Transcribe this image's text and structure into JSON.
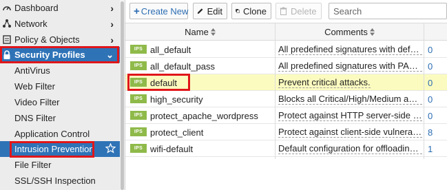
{
  "sidebar": {
    "top_items": [
      {
        "label": "Dashboard",
        "icon": "dashboard-icon"
      },
      {
        "label": "Network",
        "icon": "network-icon"
      },
      {
        "label": "Policy & Objects",
        "icon": "policy-icon"
      }
    ],
    "active_parent": {
      "label": "Security Profiles",
      "icon": "lock-icon"
    },
    "sub_items": [
      {
        "label": "AntiVirus"
      },
      {
        "label": "Web Filter"
      },
      {
        "label": "Video Filter"
      },
      {
        "label": "DNS Filter"
      },
      {
        "label": "Application Control"
      },
      {
        "label": "Intrusion Prevention",
        "selected": true
      },
      {
        "label": "File Filter"
      },
      {
        "label": "SSL/SSH Inspection"
      }
    ]
  },
  "toolbar": {
    "create_new_label": "Create New",
    "edit_label": "Edit",
    "clone_label": "Clone",
    "delete_label": "Delete",
    "search_placeholder": "Search"
  },
  "table": {
    "columns": [
      "Name",
      "Comments"
    ],
    "badge": "IPS",
    "rows": [
      {
        "name": "all_default",
        "comment": "All predefined signatures with default setting.",
        "ref": "0",
        "highlighted": false
      },
      {
        "name": "all_default_pass",
        "comment": "All predefined signatures with PASS action.",
        "ref": "0",
        "highlighted": false
      },
      {
        "name": "default",
        "comment": "Prevent critical attacks.",
        "ref": "0",
        "highlighted": true
      },
      {
        "name": "high_security",
        "comment": "Blocks all Critical/High/Medium and some Low severity vulnerabilities.",
        "ref": "0",
        "highlighted": false
      },
      {
        "name": "protect_apache_wordpress",
        "comment": "Protect against HTTP server-side vulnerabilities.",
        "ref": "0",
        "highlighted": false
      },
      {
        "name": "protect_client",
        "comment": "Protect against client-side vulnerabilities.",
        "ref": "8",
        "highlighted": false
      },
      {
        "name": "wifi-default",
        "comment": "Default configuration for offloading WiFi traffic.",
        "ref": "1",
        "highlighted": false
      }
    ]
  },
  "colors": {
    "accent": "#2f73b7",
    "highlight_row": "#fbfbc0",
    "badge": "#8fba4a",
    "annotation_box": "#e0161a"
  }
}
